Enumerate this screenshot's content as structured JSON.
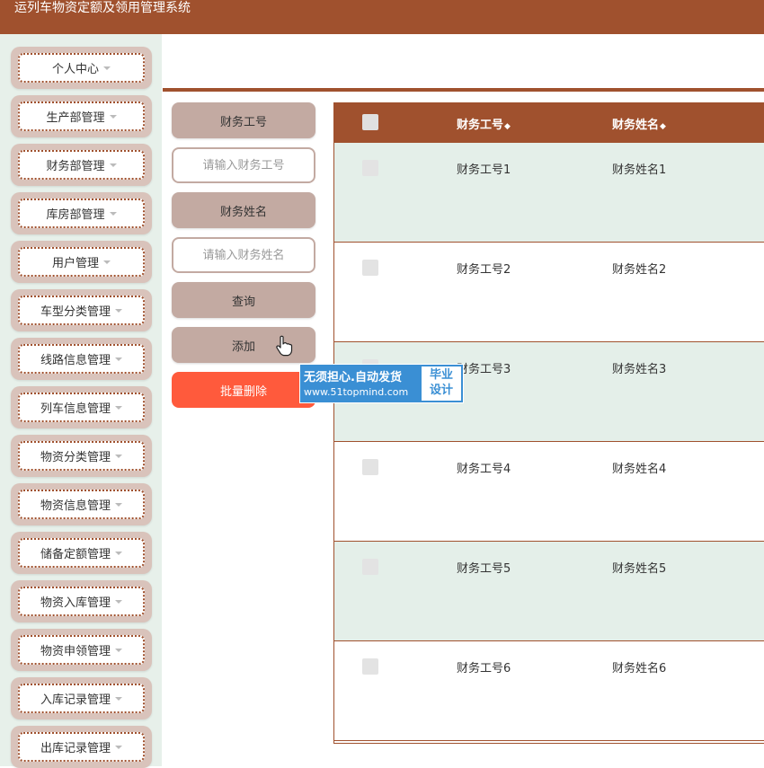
{
  "header": {
    "title": "运列车物资定额及领用管理系统"
  },
  "sidebar": {
    "items": [
      {
        "label": "个人中心"
      },
      {
        "label": "生产部管理"
      },
      {
        "label": "财务部管理"
      },
      {
        "label": "库房部管理"
      },
      {
        "label": "用户管理"
      },
      {
        "label": "车型分类管理"
      },
      {
        "label": "线路信息管理"
      },
      {
        "label": "列车信息管理"
      },
      {
        "label": "物资分类管理"
      },
      {
        "label": "物资信息管理"
      },
      {
        "label": "储备定额管理"
      },
      {
        "label": "物资入库管理"
      },
      {
        "label": "物资申领管理"
      },
      {
        "label": "入库记录管理"
      },
      {
        "label": "出库记录管理"
      }
    ]
  },
  "search": {
    "field1_label": "财务工号",
    "field1_placeholder": "请输入财务工号",
    "field2_label": "财务姓名",
    "field2_placeholder": "请输入财务姓名",
    "query_label": "查询",
    "add_label": "添加",
    "batch_delete_label": "批量删除"
  },
  "table": {
    "headers": [
      "财务工号",
      "财务姓名"
    ],
    "sort_glyph": "◆",
    "rows": [
      {
        "id": "财务工号1",
        "name": "财务姓名1"
      },
      {
        "id": "财务工号2",
        "name": "财务姓名2"
      },
      {
        "id": "财务工号3",
        "name": "财务姓名3"
      },
      {
        "id": "财务工号4",
        "name": "财务姓名4"
      },
      {
        "id": "财务工号5",
        "name": "财务姓名5"
      },
      {
        "id": "财务工号6",
        "name": "财务姓名6"
      }
    ]
  },
  "watermark": {
    "line1": "无须担心.自动发货",
    "line2": "www.51topmind.com",
    "badge_line1": "毕业",
    "badge_line2": "设计"
  },
  "colors": {
    "brand": "#a0512e",
    "sidebar_bg": "#e7f0ea",
    "button_tan": "#c3aaa2",
    "danger": "#ff5a3c",
    "row_alt": "#e4efe9"
  }
}
